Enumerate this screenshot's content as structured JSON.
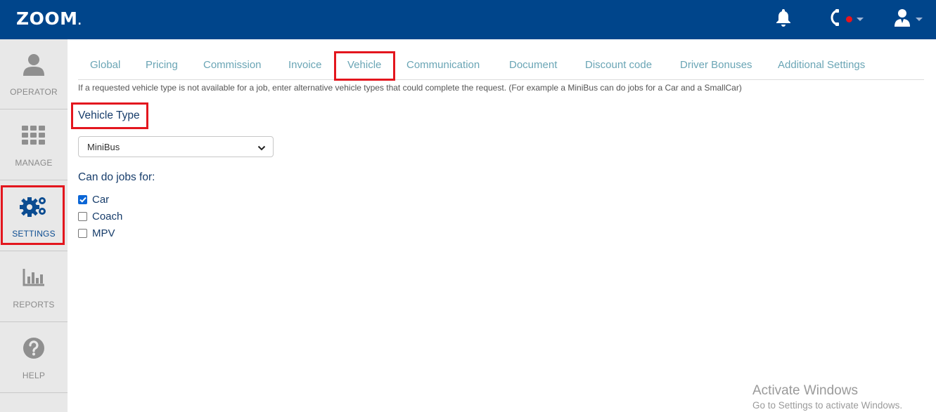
{
  "header": {
    "logo": "ZOOM",
    "logo_dot": ".",
    "icons": [
      "bell-icon",
      "phone-icon",
      "user-icon"
    ],
    "colors": {
      "bar": "#00458b",
      "status_dot": "#e8141c"
    }
  },
  "sidebar": {
    "items": [
      {
        "label": "OPERATOR",
        "icon": "person-icon"
      },
      {
        "label": "MANAGE",
        "icon": "grid-icon"
      },
      {
        "label": "SETTINGS",
        "icon": "gears-icon",
        "active": true
      },
      {
        "label": "REPORTS",
        "icon": "bar-chart-icon"
      },
      {
        "label": "HELP",
        "icon": "question-icon"
      }
    ]
  },
  "tabs": [
    {
      "label": "Global"
    },
    {
      "label": "Pricing"
    },
    {
      "label": "Commission"
    },
    {
      "label": "Invoice"
    },
    {
      "label": "Vehicle",
      "active": true
    },
    {
      "label": "Communication"
    },
    {
      "label": "Document"
    },
    {
      "label": "Discount code"
    },
    {
      "label": "Driver Bonuses"
    },
    {
      "label": "Additional Settings"
    }
  ],
  "main": {
    "info": "If a requested vehicle type is not available for a job, enter alternative vehicle types that could complete the request. (For example a MiniBus can do jobs for a Car and a SmallCar)",
    "vehicle_type_label": "Vehicle Type",
    "vehicle_type_value": "MiniBus",
    "can_do_label": "Can do jobs for:",
    "options": [
      {
        "label": "Car",
        "checked": true
      },
      {
        "label": "Coach",
        "checked": false
      },
      {
        "label": "MPV",
        "checked": false
      }
    ]
  },
  "watermark": {
    "line1": "Activate Windows",
    "line2": "Go to Settings to activate Windows."
  },
  "highlight_color": "#e3161e"
}
